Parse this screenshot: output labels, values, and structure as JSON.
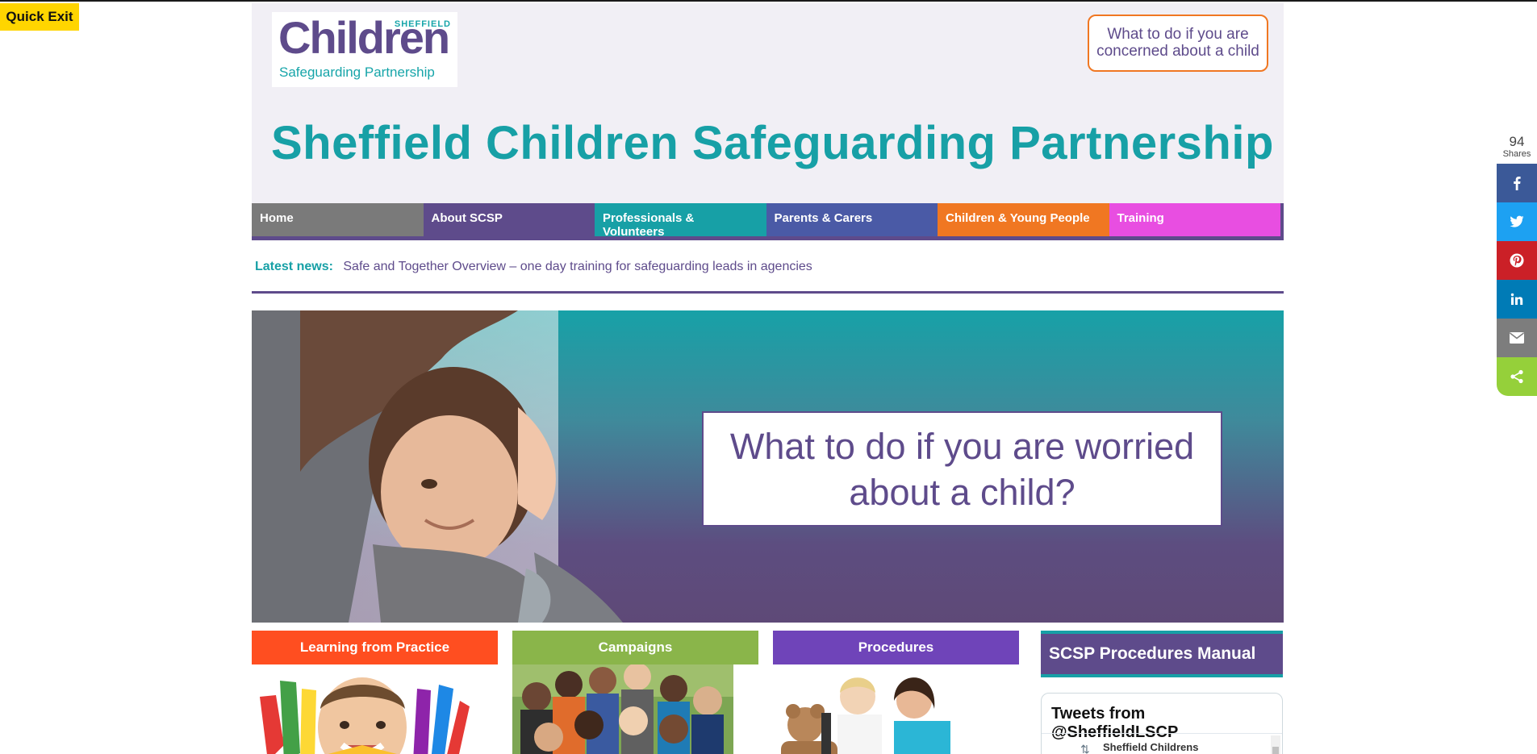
{
  "quick_exit": {
    "label": "Quick Exit"
  },
  "logo": {
    "top_text": "SHEFFIELD",
    "main_text": "Children",
    "sub_text": "Safeguarding Partnership"
  },
  "header": {
    "concern_button": "What to do if you are concerned about a child",
    "site_title": "Sheffield Children Safeguarding Partnership"
  },
  "nav": {
    "items": [
      {
        "label": "Home",
        "color": "#7a7a7a"
      },
      {
        "label": "About SCSP",
        "color": "#5e4b8b"
      },
      {
        "label": "Professionals & Volunteers",
        "color": "#17a0a6"
      },
      {
        "label": "Parents & Carers",
        "color": "#4a5aa6"
      },
      {
        "label": "Children & Young People",
        "color": "#f07722"
      },
      {
        "label": "Training",
        "color": "#e84ee1"
      }
    ]
  },
  "news": {
    "label": "Latest news:",
    "headline": "Safe and Together Overview – one day training for safeguarding leads in agencies"
  },
  "hero": {
    "heading": "What to do if you are worried about a child?"
  },
  "tiles": [
    {
      "label": "Learning from Practice",
      "color": "#ff4e20"
    },
    {
      "label": "Campaigns",
      "color": "#8ab54a"
    },
    {
      "label": "Procedures",
      "color": "#6f44b9"
    }
  ],
  "sidebar": {
    "manual": "SCSP Procedures Manual",
    "tweets_title": "Tweets from @SheffieldLSCP",
    "tweet_author": "Sheffield Childrens"
  },
  "share": {
    "count": "94",
    "label": "Shares",
    "buttons": [
      {
        "name": "facebook",
        "color": "#3b5998",
        "icon": "facebook-icon"
      },
      {
        "name": "twitter",
        "color": "#1da1f2",
        "icon": "twitter-icon"
      },
      {
        "name": "pinterest",
        "color": "#cb2027",
        "icon": "pinterest-icon"
      },
      {
        "name": "linkedin",
        "color": "#007bb6",
        "icon": "linkedin-icon"
      },
      {
        "name": "email",
        "color": "#7d7d7d",
        "icon": "email-icon"
      },
      {
        "name": "share",
        "color": "#95d03a",
        "icon": "share-icon"
      }
    ]
  }
}
